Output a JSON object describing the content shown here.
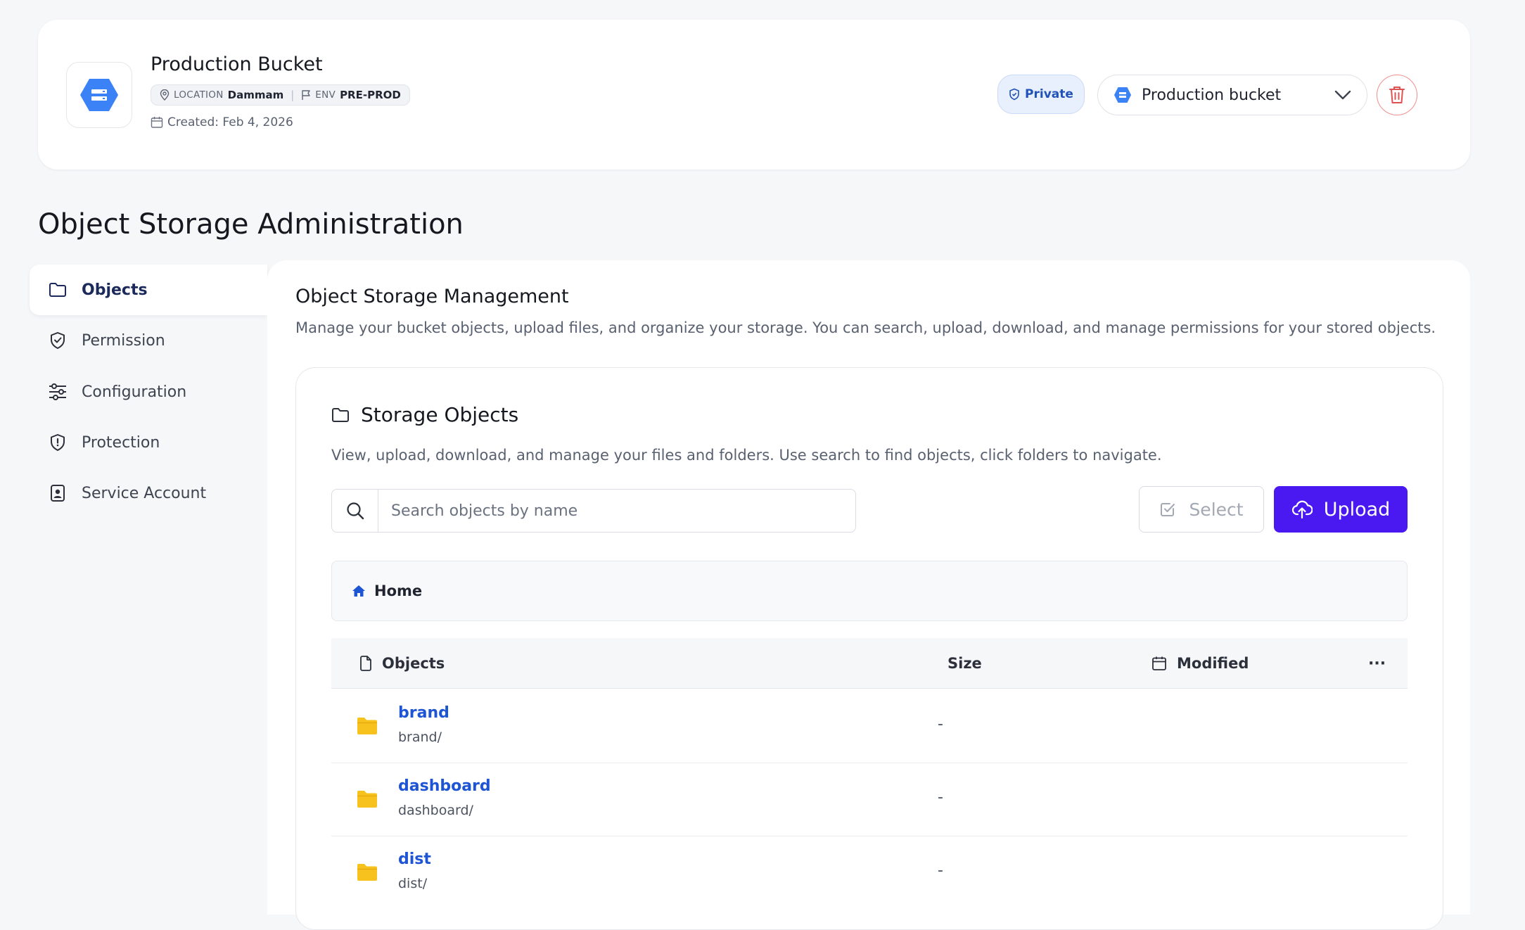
{
  "bucket": {
    "name": "Production Bucket",
    "location_key": "LOCATION",
    "location_value": "Dammam",
    "env_key": "ENV",
    "env_value": "PRE-PROD",
    "created": "Created: Feb 4, 2026",
    "visibility": "Private",
    "selector_label": "Production bucket",
    "brand_color": "#3b82f6"
  },
  "page_title": "Object Storage Administration",
  "sidebar": {
    "items": [
      {
        "label": "Objects",
        "icon": "folder-icon",
        "active": true
      },
      {
        "label": "Permission",
        "icon": "shield-check-icon",
        "active": false
      },
      {
        "label": "Configuration",
        "icon": "sliders-icon",
        "active": false
      },
      {
        "label": "Protection",
        "icon": "shield-alert-icon",
        "active": false
      },
      {
        "label": "Service Account",
        "icon": "badge-id-icon",
        "active": false
      }
    ]
  },
  "management": {
    "title": "Object Storage Management",
    "description": "Manage your bucket objects, upload files, and organize your storage. You can search, upload, download, and manage permissions for your stored objects."
  },
  "storage_objects": {
    "title": "Storage Objects",
    "description": "View, upload, download, and manage your files and folders. Use search to find objects, click folders to navigate.",
    "search_placeholder": "Search objects by name",
    "select_label": "Select",
    "upload_label": "Upload",
    "accent_color": "#4a18f0",
    "breadcrumb_home": "Home",
    "columns": {
      "objects": "Objects",
      "size": "Size",
      "modified": "Modified",
      "more": "···"
    },
    "rows": [
      {
        "name": "brand",
        "path": "brand/",
        "size": "-",
        "modified": ""
      },
      {
        "name": "dashboard",
        "path": "dashboard/",
        "size": "-",
        "modified": ""
      },
      {
        "name": "dist",
        "path": "dist/",
        "size": "-",
        "modified": ""
      }
    ]
  }
}
